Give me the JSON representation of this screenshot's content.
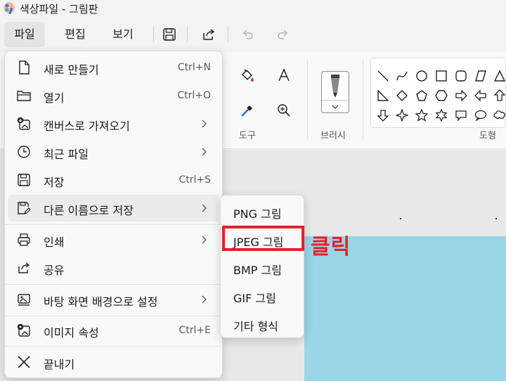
{
  "window": {
    "title": "색상파일 - 그림판"
  },
  "menubar": {
    "tabs": [
      "파일",
      "편집",
      "보기"
    ]
  },
  "ribbon": {
    "tools_label": "도구",
    "brush_label": "브러시",
    "shapes_label": "도형"
  },
  "file_menu": {
    "items": [
      {
        "label": "새로 만들기",
        "shortcut": "Ctrl+N",
        "icon": "new-file-icon"
      },
      {
        "label": "열기",
        "shortcut": "Ctrl+O",
        "icon": "folder-icon"
      },
      {
        "label": "캔버스로 가져오기",
        "shortcut": "",
        "icon": "import-image-icon"
      },
      {
        "label": "최근 파일",
        "shortcut": "",
        "icon": "clock-icon"
      },
      {
        "label": "저장",
        "shortcut": "Ctrl+S",
        "icon": "save-icon"
      },
      {
        "label": "다른 이름으로 저장",
        "shortcut": "",
        "icon": "save-as-icon"
      },
      {
        "label": "인쇄",
        "shortcut": "",
        "icon": "printer-icon"
      },
      {
        "label": "공유",
        "shortcut": "",
        "icon": "share-icon"
      },
      {
        "label": "바탕 화면 배경으로 설정",
        "shortcut": "",
        "icon": "wallpaper-icon"
      },
      {
        "label": "이미지 속성",
        "shortcut": "Ctrl+E",
        "icon": "image-properties-icon"
      },
      {
        "label": "끝내기",
        "shortcut": "",
        "icon": "close-icon"
      }
    ]
  },
  "save_as_submenu": {
    "items": [
      {
        "label": "PNG 그림"
      },
      {
        "label": "JPEG 그림"
      },
      {
        "label": "BMP 그림"
      },
      {
        "label": "GIF 그림"
      },
      {
        "label": "기타 형식"
      }
    ]
  },
  "annotation": {
    "text": "클릭",
    "color": "#e5202a"
  },
  "colors": {
    "canvas": "#9ad6e8",
    "accent": "#e5202a"
  }
}
